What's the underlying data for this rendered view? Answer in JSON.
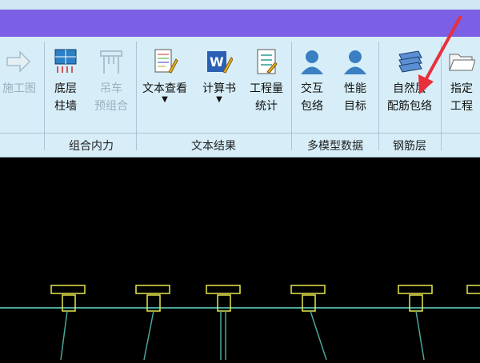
{
  "ribbon": {
    "buttons": [
      {
        "label1": "施工图",
        "label2": "",
        "disabled": true
      },
      {
        "label1": "底层",
        "label2": "柱墙",
        "disabled": false
      },
      {
        "label1": "吊车",
        "label2": "预组合",
        "disabled": true
      },
      {
        "label1": "文本查看",
        "label2": "",
        "disabled": false
      },
      {
        "label1": "计算书",
        "label2": "",
        "disabled": false
      },
      {
        "label1": "工程量",
        "label2": "统计",
        "disabled": false
      },
      {
        "label1": "交互",
        "label2": "包络",
        "disabled": false
      },
      {
        "label1": "性能",
        "label2": "目标",
        "disabled": false
      },
      {
        "label1": "自然层",
        "label2": "配筋包络",
        "disabled": false
      },
      {
        "label1": "指定",
        "label2": "工程",
        "disabled": false
      }
    ],
    "groups": [
      "组合内力",
      "文本结果",
      "多模型数据",
      "钢筋层"
    ]
  },
  "colors": {
    "accent_bar": "#7b5fe4",
    "ribbon_bg": "#d7eef8",
    "canvas_bg": "#000000",
    "highlight_arrow": "#e8303c",
    "drawing_column": "#e8e84a",
    "drawing_beam": "#4aa79a"
  }
}
